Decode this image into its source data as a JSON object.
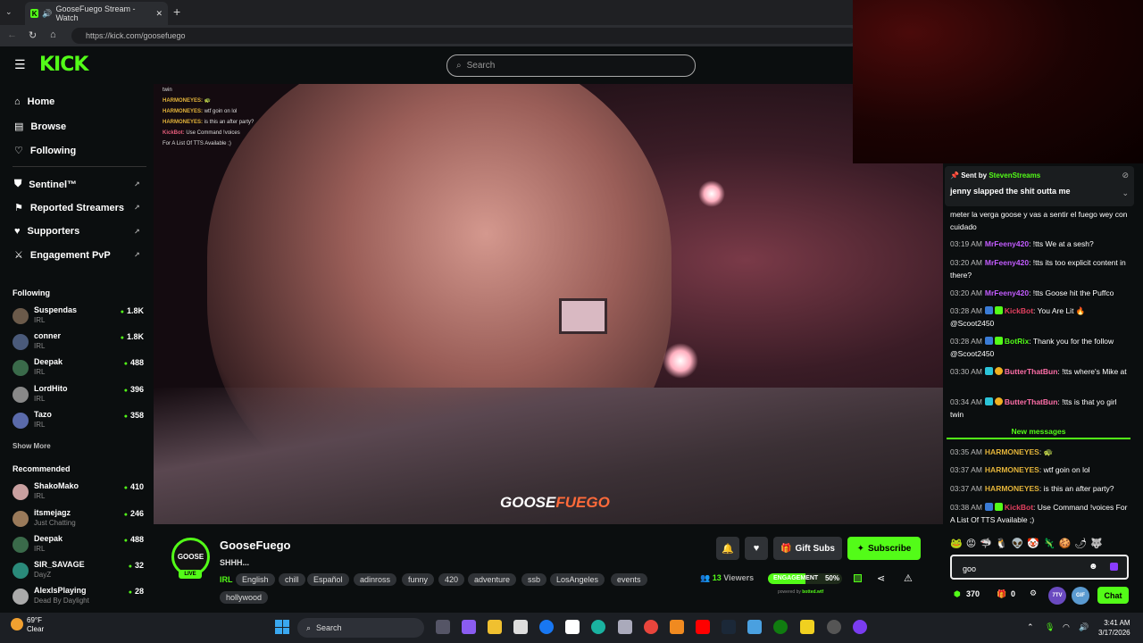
{
  "browser": {
    "tab_title": "GooseFuego Stream - Watch",
    "url": "https://kick.com/goosefuego"
  },
  "header": {
    "logo": "KICK",
    "search_placeholder": "Search"
  },
  "sidebar": {
    "nav": [
      {
        "label": "Home",
        "icon": "home-icon"
      },
      {
        "label": "Browse",
        "icon": "browse-icon"
      },
      {
        "label": "Following",
        "icon": "heart-icon"
      }
    ],
    "tools": [
      {
        "label": "Sentinel™",
        "icon": "shield-icon"
      },
      {
        "label": "Reported Streamers",
        "icon": "flag-icon"
      },
      {
        "label": "Supporters",
        "icon": "heart-icon"
      },
      {
        "label": "Engagement PvP",
        "icon": "swords-icon"
      }
    ],
    "following_title": "Following",
    "following": [
      {
        "name": "Suspendas",
        "category": "IRL",
        "viewers": "1.8K"
      },
      {
        "name": "conner",
        "category": "IRL",
        "viewers": "1.8K"
      },
      {
        "name": "Deepak",
        "category": "IRL",
        "viewers": "488"
      },
      {
        "name": "LordHito",
        "category": "IRL",
        "viewers": "396"
      },
      {
        "name": "Tazo",
        "category": "IRL",
        "viewers": "358"
      }
    ],
    "show_more": "Show More",
    "recommended_title": "Recommended",
    "recommended": [
      {
        "name": "ShakoMako",
        "category": "IRL",
        "viewers": "410"
      },
      {
        "name": "itsmejagz",
        "category": "Just Chatting",
        "viewers": "246"
      },
      {
        "name": "Deepak",
        "category": "IRL",
        "viewers": "488"
      },
      {
        "name": "SIR_SAVAGE",
        "category": "DayZ",
        "viewers": "32"
      },
      {
        "name": "AlexlsPlaying",
        "category": "Dead By Daylight",
        "viewers": "28"
      }
    ]
  },
  "video": {
    "overlay_chat": [
      {
        "user": "",
        "text": "twin"
      },
      {
        "user": "HARMONEYES:",
        "text": "🐢"
      },
      {
        "user": "HARMONEYES:",
        "text": "wtf goin on lol"
      },
      {
        "user": "HARMONEYES:",
        "text": "is this an after party?"
      },
      {
        "user": "KickBot:",
        "text": "Use Command !voices"
      },
      {
        "user": "",
        "text": "For A List Of TTS Available ;)"
      }
    ],
    "watermark_a": "GOOSE",
    "watermark_b": "FUEGO"
  },
  "stream": {
    "avatar_text": "GOOSE",
    "live": "LIVE",
    "streamer": "GooseFuego",
    "title": "SHHH...",
    "category": "IRL",
    "tags": [
      "English",
      "chill",
      "Español",
      "adinross",
      "funny",
      "420",
      "adventure",
      "ssb",
      "LosAngeles",
      "events",
      "hollywood"
    ],
    "gift_subs": "Gift Subs",
    "subscribe": "Subscribe",
    "viewers_count": "13",
    "viewers_label": "Viewers",
    "engagement_label": "ENGAGEMENT",
    "engagement_pct": "50%",
    "engagement_value": 0.5,
    "powered_by": "powered by",
    "powered_brand": "botted.wtf"
  },
  "chat": {
    "pinned_sent_by": "Sent by",
    "pinned_user": "StevenStreams",
    "pinned_text": "jenny slapped the shit outta me",
    "messages": [
      {
        "time": "",
        "user": "",
        "color": "#ffffff",
        "text": "meter la verga goose y vas a sentir el fuego wey con cuidado"
      },
      {
        "time": "03:19 AM",
        "user": "MrFeeny420",
        "color": "#c35cff",
        "text": "!tts We at a sesh?"
      },
      {
        "time": "03:20 AM",
        "user": "MrFeeny420",
        "color": "#c35cff",
        "text": "!tts its too explicit content in there?"
      },
      {
        "time": "03:20 AM",
        "user": "MrFeeny420",
        "color": "#c35cff",
        "text": "!tts Goose hit the Puffco"
      },
      {
        "time": "03:28 AM",
        "user": "KickBot",
        "color": "#e4405f",
        "text": "You Are Lit 🔥 @Scoot2450"
      },
      {
        "time": "03:28 AM",
        "user": "BotRix",
        "color": "#53fc18",
        "text": "Thank you for the follow @Scoot2450"
      },
      {
        "time": "03:30 AM",
        "user": "ButterThatBun",
        "color": "#ff6fa8",
        "text": "!tts where's Mike at"
      },
      {
        "time": "03:34 AM",
        "user": "ButterThatBun",
        "color": "#ff6fa8",
        "text": "!tts is that yo girl twin"
      }
    ],
    "new_messages": "New messages",
    "new": [
      {
        "time": "03:35 AM",
        "user": "HARMONEYES",
        "color": "#e2b33a",
        "text": "🐢"
      },
      {
        "time": "03:37 AM",
        "user": "HARMONEYES",
        "color": "#e2b33a",
        "text": "wtf goin on lol"
      },
      {
        "time": "03:37 AM",
        "user": "HARMONEYES",
        "color": "#e2b33a",
        "text": "is this an after party?"
      },
      {
        "time": "03:38 AM",
        "user": "KickBot",
        "color": "#e4405f",
        "text": "Use Command !voices For A List Of TTS Available ;)"
      }
    ],
    "input_value": "goo",
    "points": "370",
    "gifts": "0",
    "send": "Chat",
    "badge_7tv": "7TV",
    "badge_gif": "GIF"
  },
  "taskbar": {
    "temp": "69°F",
    "weather": "Clear",
    "search": "Search",
    "time": "3:41 AM",
    "date": "3/17/2026"
  }
}
